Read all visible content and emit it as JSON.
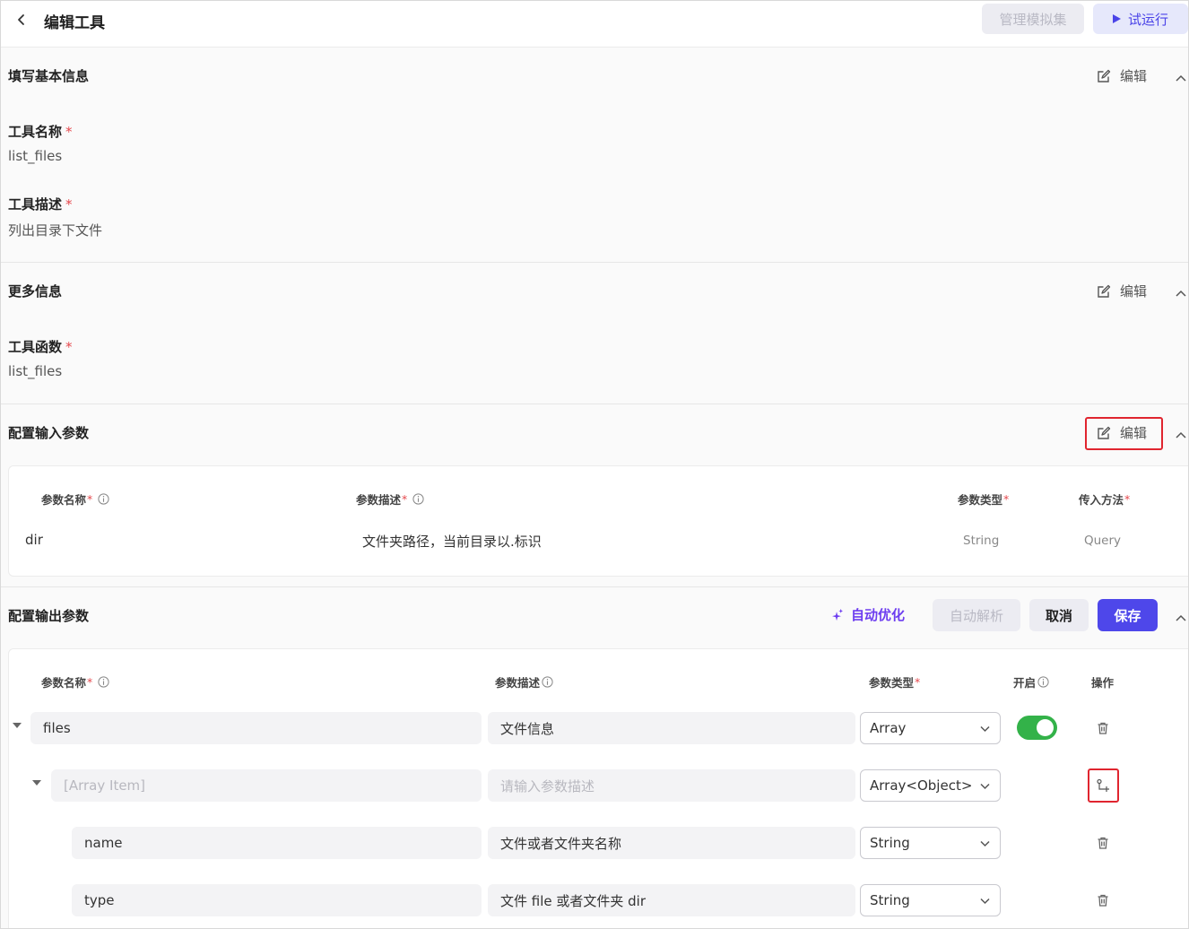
{
  "header": {
    "title": "编辑工具",
    "manage_mock_label": "管理模拟集",
    "run_label": "试运行"
  },
  "basic": {
    "title": "填写基本信息",
    "edit_label": "编辑",
    "name_label": "工具名称",
    "name_value": "list_files",
    "desc_label": "工具描述",
    "desc_value": "列出目录下文件"
  },
  "more": {
    "title": "更多信息",
    "edit_label": "编辑",
    "func_label": "工具函数",
    "func_value": "list_files"
  },
  "input": {
    "title": "配置输入参数",
    "edit_label": "编辑",
    "columns": {
      "name": "参数名称",
      "desc": "参数描述",
      "type": "参数类型",
      "method": "传入方法"
    },
    "rows": [
      {
        "name": "dir",
        "desc": "文件夹路径，当前目录以.标识",
        "type": "String",
        "method": "Query"
      }
    ]
  },
  "output": {
    "title": "配置输出参数",
    "auto_optimize_label": "自动优化",
    "auto_parse_label": "自动解析",
    "cancel_label": "取消",
    "save_label": "保存",
    "columns": {
      "name": "参数名称",
      "desc": "参数描述",
      "type": "参数类型",
      "enable": "开启",
      "ops": "操作"
    },
    "rows": [
      {
        "name": "files",
        "desc": "文件信息",
        "type": "Array",
        "enabled": true
      },
      {
        "name_placeholder": "[Array Item]",
        "desc_placeholder": "请输入参数描述",
        "type": "Array<Object>"
      },
      {
        "name": "name",
        "desc": "文件或者文件夹名称",
        "type": "String"
      },
      {
        "name": "type",
        "desc": "文件 file 或者文件夹 dir",
        "type": "String"
      }
    ]
  },
  "colors": {
    "primary": "#4e47ea",
    "accent_purple": "#6d3df0",
    "toggle_on": "#33b249",
    "highlight": "#e0252f",
    "required": "#e5484d"
  }
}
